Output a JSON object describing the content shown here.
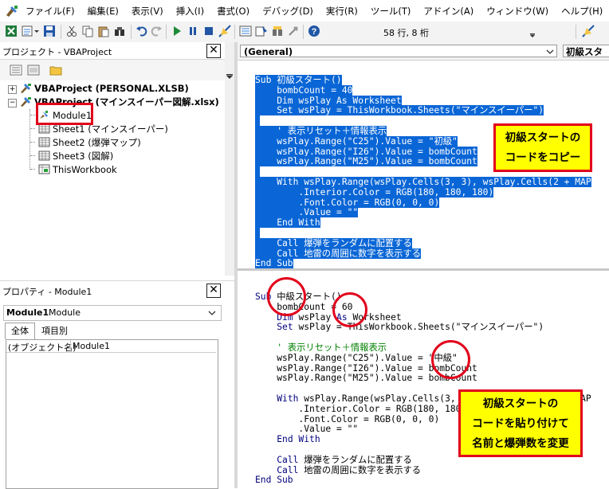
{
  "menu": {
    "items": [
      "ファイル(F)",
      "編集(E)",
      "表示(V)",
      "挿入(I)",
      "書式(O)",
      "デバッグ(D)",
      "実行(R)",
      "ツール(T)",
      "アドイン(A)",
      "ウィンドウ(W)",
      "ヘルプ(H)"
    ]
  },
  "toolbar": {
    "status": "58 行, 8 桁",
    "icons": [
      "excel-icon",
      "insert-module-icon",
      "save-icon",
      "cut-icon",
      "copy-icon",
      "paste-icon",
      "find-icon",
      "undo-icon",
      "redo-icon",
      "run-icon",
      "break-icon",
      "reset-icon",
      "design-mode-icon",
      "project-explorer-icon",
      "properties-icon",
      "object-browser-icon",
      "toolbox-icon",
      "help-icon",
      "comment-icon"
    ]
  },
  "project": {
    "title": "プロジェクト - VBAProject",
    "close": "✕",
    "tree": [
      {
        "label": "VBAProject (PERSONAL.XLSB)",
        "bold": true
      },
      {
        "label": "VBAProject (マインスイーパー図解.xlsx)",
        "bold": true
      },
      {
        "label": "Module1",
        "bold": false
      },
      {
        "label": "Sheet1 (マインスイーパー)",
        "bold": false
      },
      {
        "label": "Sheet2 (爆弾マップ)",
        "bold": false
      },
      {
        "label": "Sheet3 (図解)",
        "bold": false
      },
      {
        "label": "ThisWorkbook",
        "bold": false
      }
    ]
  },
  "properties": {
    "title": "プロパティ - Module1",
    "close": "✕",
    "combo_name": "Module1",
    "combo_type": "Module",
    "tab_all": "全体",
    "tab_category": "項目別",
    "row_key": "(オブジェクト名)",
    "row_value": "Module1"
  },
  "code": {
    "object_combo": "(General)",
    "proc_combo": "初級スタ",
    "top_lines": [
      "Sub 初級スタート()",
      "    bombCount = 40",
      "    Dim wsPlay As Worksheet",
      "    Set wsPlay = ThisWorkbook.Sheets(\"マインスイーパー\")",
      "",
      "    ' 表示リセット＋情報表示",
      "    wsPlay.Range(\"C25\").Value = \"初級\"",
      "    wsPlay.Range(\"I26\").Value = bombCount",
      "    wsPlay.Range(\"M25\").Value = bombCount",
      "",
      "    With wsPlay.Range(wsPlay.Cells(3, 3), wsPlay.Cells(2 + MAP",
      "        .Interior.Color = RGB(180, 180, 180)",
      "        .Font.Color = RGB(0, 0, 0)",
      "        .Value = \"\"",
      "    End With",
      "",
      "    Call 爆弾をランダムに配置する",
      "    Call 地雷の周囲に数字を表示する",
      "End Sub"
    ],
    "bottom_lines": [
      "Sub 中級スタート()",
      "    bombCount = 60",
      "    Dim wsPlay As Worksheet",
      "    Set wsPlay = ThisWorkbook.Sheets(\"マインスイーパー\")",
      "",
      "    ' 表示リセット＋情報表示",
      "    wsPlay.Range(\"C25\").Value = \"中級\"",
      "    wsPlay.Range(\"I26\").Value = bombCount",
      "    wsPlay.Range(\"M25\").Value = bombCount",
      "",
      "    With wsPlay.Range(wsPlay.Cells(3, 3), wsPlay.Cells(2 + MAP",
      "        .Interior.Color = RGB(180, 180, 180)",
      "        .Font.Color = RGB(0, 0, 0)",
      "        .Value = \"\"",
      "    End With",
      "",
      "    Call 爆弾をランダムに配置する",
      "    Call 地雷の周囲に数字を表示する",
      "End Sub"
    ]
  },
  "annotations": {
    "copy_note": [
      "初級スタートの",
      "コードをコピー"
    ],
    "paste_note": [
      "初級スタートの",
      "コードを貼り付けて",
      "名前と爆弾数を変更"
    ]
  },
  "colors": {
    "selection": "#0a66d6",
    "annotation_red": "#e2001a",
    "annotation_yellow": "#ffff00"
  }
}
